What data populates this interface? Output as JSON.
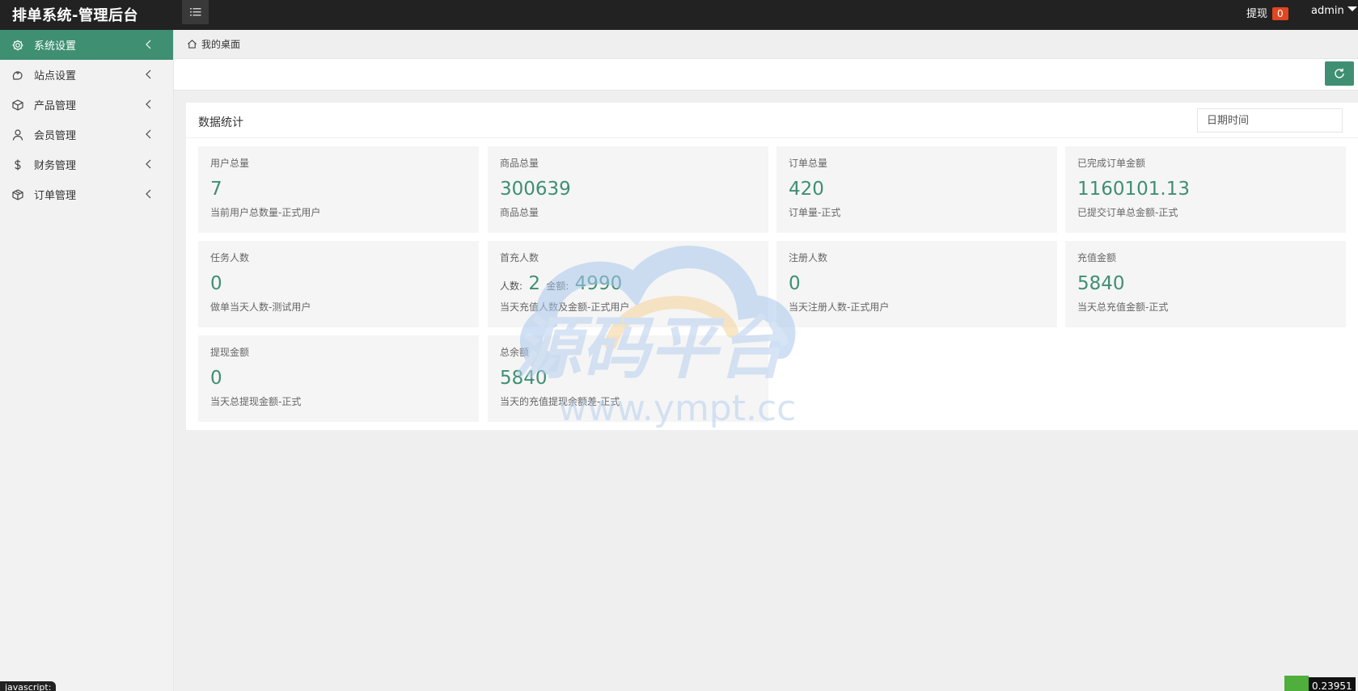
{
  "app": {
    "title": "排单系统-管理后台"
  },
  "header": {
    "withdraw_label": "提现",
    "withdraw_badge": "0",
    "user": "admin"
  },
  "sidebar": {
    "items": [
      {
        "label": "系统设置",
        "icon": "gear-icon"
      },
      {
        "label": "站点设置",
        "icon": "site-icon"
      },
      {
        "label": "产品管理",
        "icon": "box-icon"
      },
      {
        "label": "会员管理",
        "icon": "user-icon"
      },
      {
        "label": "财务管理",
        "icon": "dollar-icon"
      },
      {
        "label": "订单管理",
        "icon": "order-box-icon"
      }
    ]
  },
  "breadcrumb": {
    "label": "我的桌面"
  },
  "stats": {
    "title": "数据统计",
    "date_placeholder": "日期时间",
    "tiles": [
      {
        "label": "用户总量",
        "value": "7",
        "desc": "当前用户总数量-正式用户"
      },
      {
        "label": "商品总量",
        "value": "300639",
        "desc": "商品总量"
      },
      {
        "label": "订单总量",
        "value": "420",
        "desc": "订单量-正式"
      },
      {
        "label": "已完成订单金额",
        "value": "1160101.13",
        "desc": "已提交订单总金额-正式"
      },
      {
        "label": "任务人数",
        "value": "0",
        "desc": "做单当天人数-测试用户"
      },
      {
        "label": "首充人数",
        "count_label": "人数:",
        "count": "2",
        "amount_label": "金额:",
        "amount": "4990",
        "desc": "当天充值人数及金额-正式用户"
      },
      {
        "label": "注册人数",
        "value": "0",
        "desc": "当天注册人数-正式用户"
      },
      {
        "label": "充值金额",
        "value": "5840",
        "desc": "当天总充值金额-正式"
      },
      {
        "label": "提现金额",
        "value": "0",
        "desc": "当天总提现金额-正式"
      },
      {
        "label": "总余额",
        "value": "5840",
        "desc": "当天的充值提现余额差-正式"
      }
    ]
  },
  "watermark": {
    "text": "源码平台",
    "url": "www.ympt.cc"
  },
  "status": {
    "js_text": "javascript:",
    "number": "0.23951"
  },
  "colors": {
    "accent": "#3f8f73",
    "topbar": "#222222",
    "badge": "#e0461f"
  }
}
